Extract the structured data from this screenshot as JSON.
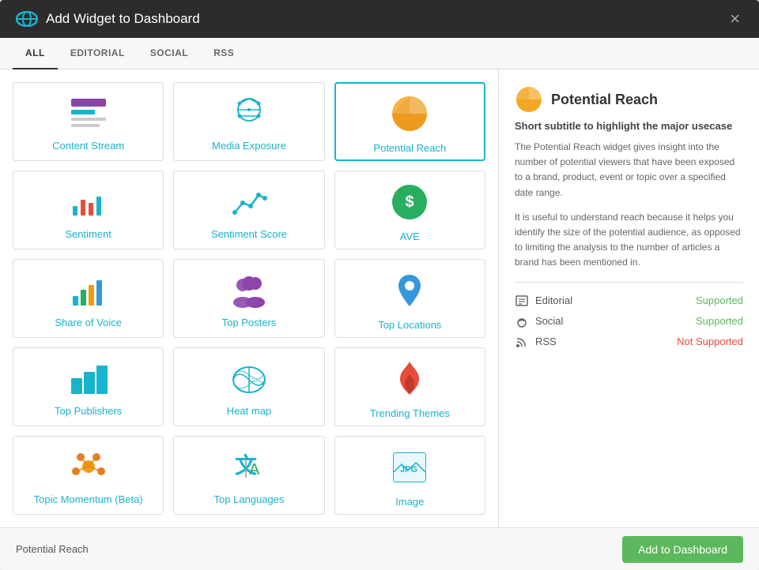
{
  "modal": {
    "title": "Add Widget to Dashboard",
    "close_label": "×"
  },
  "tabs": [
    {
      "id": "all",
      "label": "ALL",
      "active": true
    },
    {
      "id": "editorial",
      "label": "EDITORIAL",
      "active": false
    },
    {
      "id": "social",
      "label": "SOCIAL",
      "active": false
    },
    {
      "id": "rss",
      "label": "RSS",
      "active": false
    }
  ],
  "widgets": [
    {
      "id": "content-stream",
      "label": "Content Stream",
      "selected": false
    },
    {
      "id": "media-exposure",
      "label": "Media Exposure",
      "selected": false
    },
    {
      "id": "potential-reach",
      "label": "Potential Reach",
      "selected": true
    },
    {
      "id": "sentiment",
      "label": "Sentiment",
      "selected": false
    },
    {
      "id": "sentiment-score",
      "label": "Sentiment Score",
      "selected": false
    },
    {
      "id": "ave",
      "label": "AVE",
      "selected": false
    },
    {
      "id": "share-of-voice",
      "label": "Share of Voice",
      "selected": false
    },
    {
      "id": "top-posters",
      "label": "Top Posters",
      "selected": false
    },
    {
      "id": "top-locations",
      "label": "Top Locations",
      "selected": false
    },
    {
      "id": "top-publishers",
      "label": "Top Publishers",
      "selected": false
    },
    {
      "id": "heat-map",
      "label": "Heat map",
      "selected": false
    },
    {
      "id": "trending-themes",
      "label": "Trending Themes",
      "selected": false
    },
    {
      "id": "topic-momentum",
      "label": "Topic Momentum (Beta)",
      "selected": false
    },
    {
      "id": "top-languages",
      "label": "Top Languages",
      "selected": false
    },
    {
      "id": "image",
      "label": "Image",
      "selected": false
    }
  ],
  "detail": {
    "title": "Potential Reach",
    "subtitle": "Short subtitle to highlight the major usecase",
    "description1": "The Potential Reach widget gives insight into the number of potential viewers that have been exposed to a brand, product, event or topic over a specified date range.",
    "description2": "It is useful to understand reach because it helps you identify the size of the potential audience, as opposed to limiting the analysis to the number of articles a brand has been mentioned in.",
    "support": [
      {
        "type": "editorial",
        "label": "Editorial",
        "status": "Supported",
        "supported": true
      },
      {
        "type": "social",
        "label": "Social",
        "status": "Supported",
        "supported": true
      },
      {
        "type": "rss",
        "label": "RSS",
        "status": "Not Supported",
        "supported": false
      }
    ]
  },
  "footer": {
    "selected_label": "Potential Reach",
    "add_button_label": "Add to Dashboard"
  }
}
